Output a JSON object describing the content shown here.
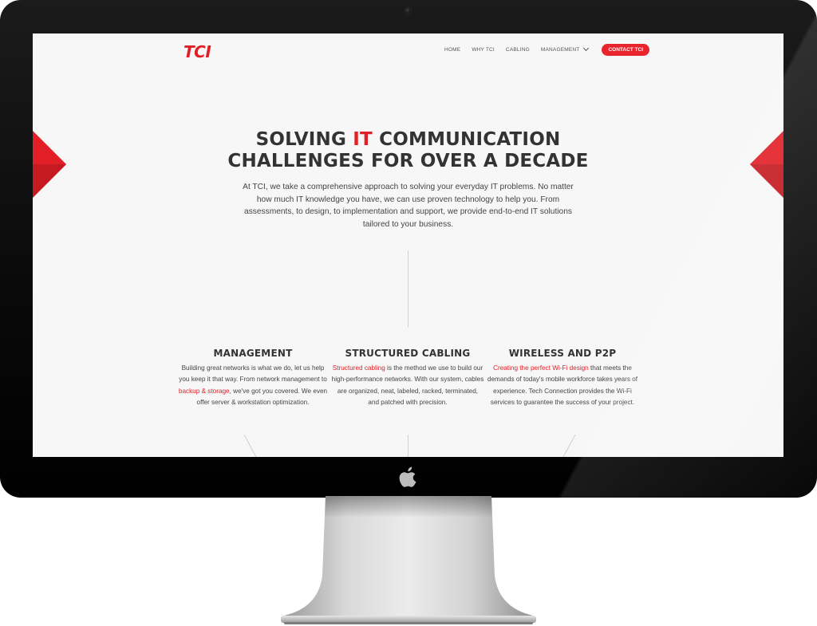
{
  "site": {
    "logo": "TCI",
    "nav": {
      "home": "HOME",
      "why": "WHY TCI",
      "cabling": "CABLING",
      "management": "MANAGEMENT",
      "contact": "CONTACT TCI"
    },
    "hero": {
      "title_pre": "SOLVING ",
      "title_accent": "IT",
      "title_post": " COMMUNICATION CHALLENGES FOR OVER A DECADE",
      "text": "At TCI, we take a comprehensive approach to solving your everyday IT problems. No matter how much IT knowledge you have, we can use proven technology to help you. From assessments, to design, to implementation and support, we provide end-to-end IT solutions tailored to your business."
    },
    "columns": [
      {
        "title": "MANAGEMENT",
        "text_pre": "Building great networks is what we do, let us help you keep it that way. From network management to ",
        "link": "backup & storage",
        "text_post": ", we've got you covered. We even offer server & workstation optimization."
      },
      {
        "title": "STRUCTURED CABLING",
        "text_pre": "",
        "link": "Structured cabling",
        "text_post": " is the method we use to build our high-performance networks. With our system, cables are organized, neat, labeled, racked, terminated, and patched with precision."
      },
      {
        "title": "WIRELESS AND P2P",
        "text_pre": "",
        "link": "Creating the perfect Wi-Fi design",
        "text_post": " that meets the demands of today's mobile workforce takes years of experience. Tech Connection provides the Wi-Fi services to guarantee the success of your project."
      }
    ],
    "colors": {
      "accent": "#e21f26",
      "text": "#333333",
      "background": "#f7f7f7"
    }
  },
  "icons": [
    "camera-icon",
    "apple-logo-icon",
    "chevron-down-icon",
    "red-arrow-left-icon",
    "red-arrow-right-icon"
  ]
}
